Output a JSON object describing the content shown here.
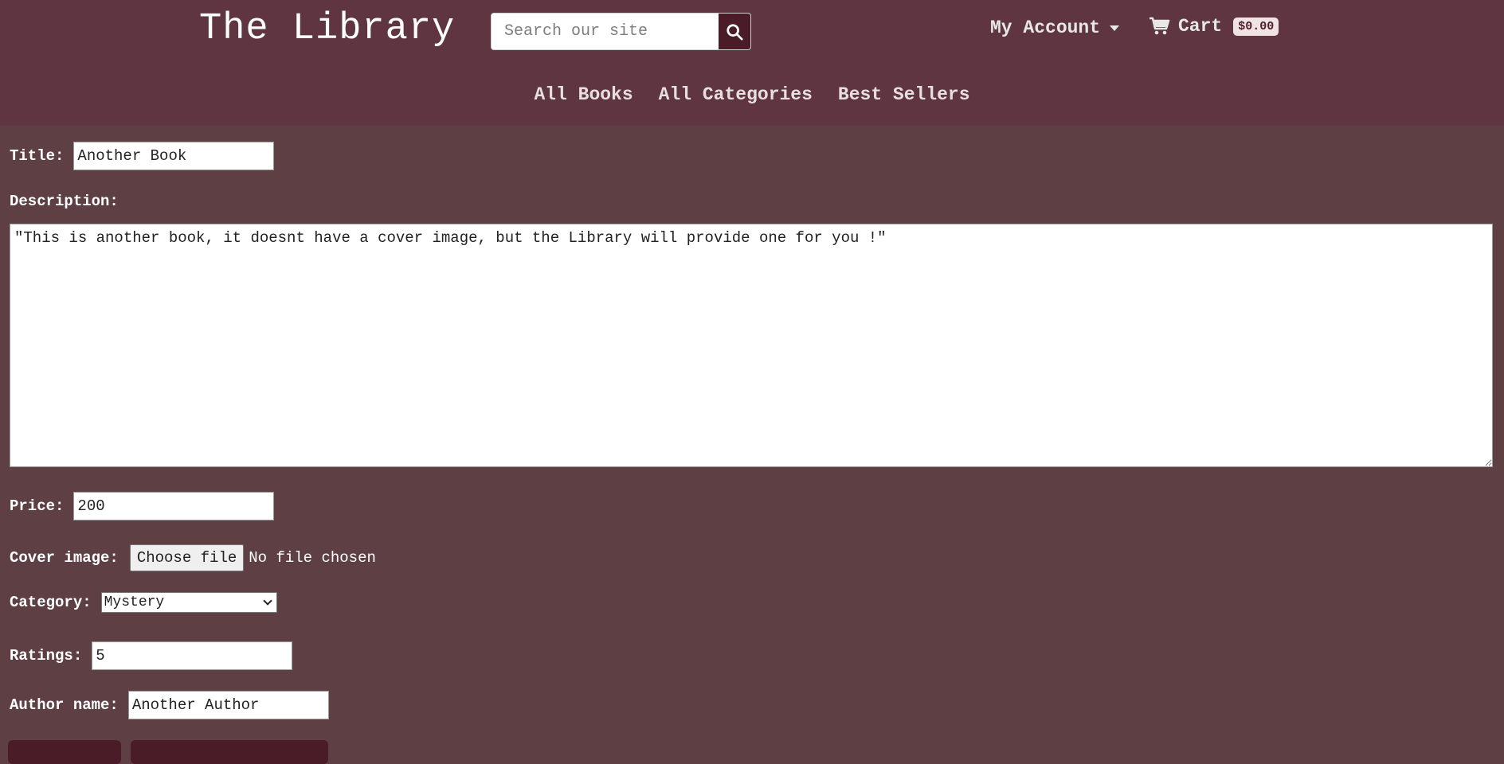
{
  "header": {
    "brand": "The Library",
    "search_placeholder": "Search our site",
    "account_label": "My Account",
    "cart_label": "Cart",
    "cart_total": "$0.00"
  },
  "nav": {
    "items": [
      "All Books",
      "All Categories",
      "Best Sellers"
    ]
  },
  "form": {
    "title_label": "Title:",
    "title_value": "Another Book",
    "description_label": "Description:",
    "description_value": "\"This is another book, it doesnt have a cover image, but the Library will provide one for you !\"",
    "price_label": "Price:",
    "price_value": "200",
    "cover_label": "Cover image:",
    "cover_button": "Choose file",
    "cover_status": "No file chosen",
    "category_label": "Category:",
    "category_value": "Mystery",
    "ratings_label": "Ratings:",
    "ratings_value": "5",
    "author_label": "Author name:",
    "author_value": "Another Author"
  },
  "colors": {
    "header_bg": "#5e3540",
    "page_bg": "#5e4044",
    "accent": "#4a1c28"
  },
  "icons": {
    "search": "search-icon",
    "cart": "cart-icon",
    "caret": "chevron-down-icon"
  }
}
